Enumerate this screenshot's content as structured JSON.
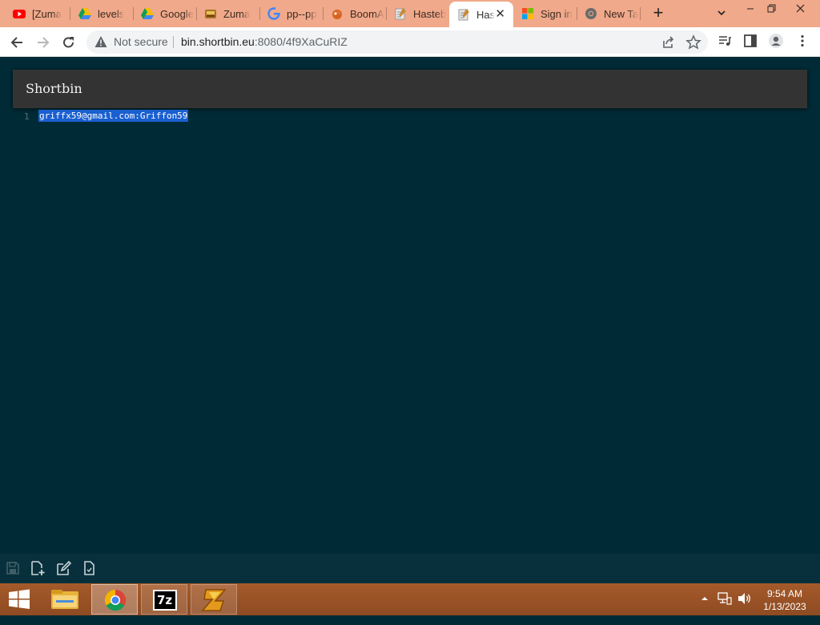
{
  "browser": {
    "tabs": [
      {
        "title": "[Zuma",
        "icon": "youtube-icon"
      },
      {
        "title": "levels",
        "icon": "google-drive-icon"
      },
      {
        "title": "Google",
        "icon": "google-drive-icon"
      },
      {
        "title": "Zuma",
        "icon": "zuma-game-icon"
      },
      {
        "title": "pp--pp",
        "icon": "google-icon"
      },
      {
        "title": "BoomA",
        "icon": "boom-icon"
      },
      {
        "title": "Hasteb",
        "icon": "hastebin-icon"
      },
      {
        "title": "Has",
        "icon": "hastebin-icon",
        "active": true
      },
      {
        "title": "Sign in",
        "icon": "microsoft-icon"
      },
      {
        "title": "New Ta",
        "icon": "chrome-icon"
      }
    ],
    "new_tab": "+",
    "address": {
      "security_label": "Not secure",
      "host": "bin.shortbin.eu",
      "rest": ":8080/4f9XaCuRIZ"
    },
    "accent": "#f0a98a"
  },
  "page": {
    "brand": "Shortbin",
    "lines": [
      {
        "number": "1",
        "text": "griffx59@gmail.com:Griffon59",
        "selected": true
      }
    ],
    "background": "#002b36"
  },
  "taskbar": {
    "time": "9:54 AM",
    "date": "1/13/2023",
    "apps": [
      "file-explorer-icon",
      "chrome-icon",
      "7zip-icon",
      "zuma-game-icon"
    ],
    "sevenzip_label": "7z"
  }
}
